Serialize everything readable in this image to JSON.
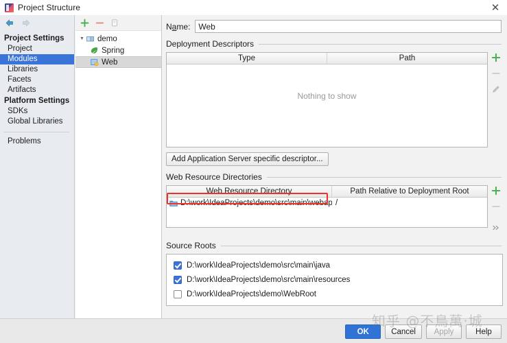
{
  "window": {
    "title": "Project Structure",
    "app_icon": "intellij-idea-icon",
    "close_label": "✕"
  },
  "sidebar": {
    "nav": {
      "back_icon": "arrow-left-icon",
      "forward_icon": "arrow-right-icon"
    },
    "items": [
      {
        "label": "Project Settings",
        "type": "group",
        "selected": false
      },
      {
        "label": "Project",
        "type": "item",
        "selected": false
      },
      {
        "label": "Modules",
        "type": "item",
        "selected": true
      },
      {
        "label": "Libraries",
        "type": "item",
        "selected": false
      },
      {
        "label": "Facets",
        "type": "item",
        "selected": false
      },
      {
        "label": "Artifacts",
        "type": "item",
        "selected": false
      },
      {
        "label": "Platform Settings",
        "type": "group",
        "selected": false
      },
      {
        "label": "SDKs",
        "type": "item",
        "selected": false
      },
      {
        "label": "Global Libraries",
        "type": "item",
        "selected": false
      },
      {
        "label": "Problems",
        "type": "item",
        "selected": false
      }
    ]
  },
  "modules_pane": {
    "toolbar": {
      "add_icon": "plus-icon",
      "remove_icon": "minus-icon",
      "copy_icon": "copy-icon"
    },
    "tree": [
      {
        "label": "demo",
        "icon": "module-icon",
        "depth": 0,
        "expanded": true,
        "selected": false
      },
      {
        "label": "Spring",
        "icon": "spring-leaf-icon",
        "depth": 1,
        "expanded": false,
        "selected": false
      },
      {
        "label": "Web",
        "icon": "web-globe-icon",
        "depth": 1,
        "expanded": false,
        "selected": true
      }
    ]
  },
  "main": {
    "name_field": {
      "label": "Name:",
      "value": "Web",
      "placeholder": ""
    },
    "deployment_descriptors": {
      "title": "Deployment Descriptors",
      "columns": [
        "Type",
        "Path"
      ],
      "rows": [],
      "empty_text": "Nothing to show",
      "side_buttons": [
        "plus-icon",
        "minus-icon",
        "edit-pencil-icon"
      ],
      "add_button_label": "Add Application Server specific descriptor..."
    },
    "web_resource_directories": {
      "title": "Web Resource Directories",
      "columns": [
        "Web Resource Directory",
        "Path Relative to Deployment Root"
      ],
      "rows": [
        {
          "directory": "D:\\work\\IdeaProjects\\demo\\src\\main\\webapp",
          "relative_path": "/",
          "icon": "folder-icon"
        }
      ],
      "side_buttons": [
        "plus-icon",
        "minus-icon",
        "expand-chevrons-icon"
      ]
    },
    "source_roots": {
      "title": "Source Roots",
      "items": [
        {
          "path": "D:\\work\\IdeaProjects\\demo\\src\\main\\java",
          "checked": true
        },
        {
          "path": "D:\\work\\IdeaProjects\\demo\\src\\main\\resources",
          "checked": true
        },
        {
          "path": "D:\\work\\IdeaProjects\\demo\\WebRoot",
          "checked": false
        }
      ]
    }
  },
  "footer": {
    "ok": "OK",
    "cancel": "Cancel",
    "apply": "Apply",
    "help": "Help"
  },
  "overlay": {
    "watermark": "知乎 @不鳥萬·城",
    "annotation_color": "#e8342a"
  }
}
